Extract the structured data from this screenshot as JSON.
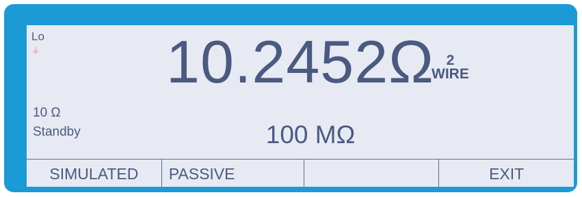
{
  "display": {
    "mode": "Lo",
    "ground_symbol": "⏚",
    "main_value": "10.2452Ω",
    "wire_count": "2",
    "wire_label": "WIRE",
    "range": "10 Ω",
    "state": "Standby",
    "secondary_value": "100 MΩ"
  },
  "softkeys": [
    "SIMULATED",
    "PASSIVE",
    "",
    "EXIT"
  ],
  "colors": {
    "bezel": "#1b9ad6",
    "screen": "#e8eaf3",
    "text": "#4a5a80"
  }
}
